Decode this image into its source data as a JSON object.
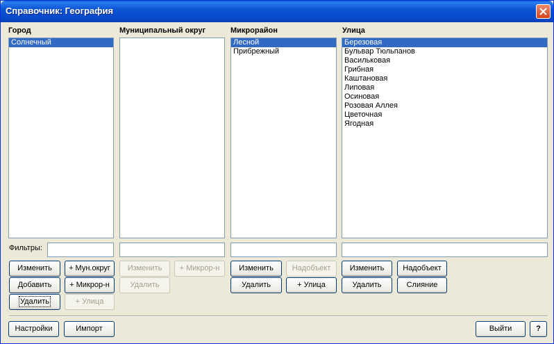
{
  "window": {
    "title": "Справочник: География"
  },
  "columns": {
    "city": {
      "header": "Город",
      "items": [
        "Солнечный"
      ],
      "selected": 0
    },
    "district": {
      "header": "Муниципальный округ",
      "items": []
    },
    "microdistrict": {
      "header": "Микрорайон",
      "items": [
        "Лесной",
        "Прибрежный"
      ],
      "selected": 0
    },
    "street": {
      "header": "Улица",
      "items": [
        "Березовая",
        "Бульвар Тюльпанов",
        "Васильковая",
        "Грибная",
        "Каштановая",
        "Липовая",
        "Осиновая",
        "Розовая Аллея",
        "Цветочная",
        "Ягодная"
      ],
      "selected": 0
    }
  },
  "filters": {
    "label": "Фильтры:",
    "city": "",
    "district": "",
    "microdistrict": "",
    "street": ""
  },
  "buttons": {
    "city_edit": "Изменить",
    "city_add": "Добавить",
    "city_delete": "Удалить",
    "city_add_district": "+ Мун.округ",
    "city_add_microdistrict": "+ Микрор-н",
    "city_add_street": "+ Улица",
    "district_edit": "Изменить",
    "district_delete": "Удалить",
    "district_add_microdistrict": "+ Микрор-н",
    "micro_edit": "Изменить",
    "micro_delete": "Удалить",
    "micro_parent": "Надобъект",
    "micro_add_street": "+ Улица",
    "street_edit": "Изменить",
    "street_delete": "Удалить",
    "street_parent": "Надобъект",
    "street_merge": "Слияние",
    "settings": "Настройки",
    "import": "Импорт",
    "exit": "Выйти",
    "help": "?"
  },
  "colors": {
    "selection": "#316ac5",
    "titlebar": "#0b54d4",
    "face": "#ece9d8"
  },
  "icons": {
    "close": "close-icon"
  }
}
